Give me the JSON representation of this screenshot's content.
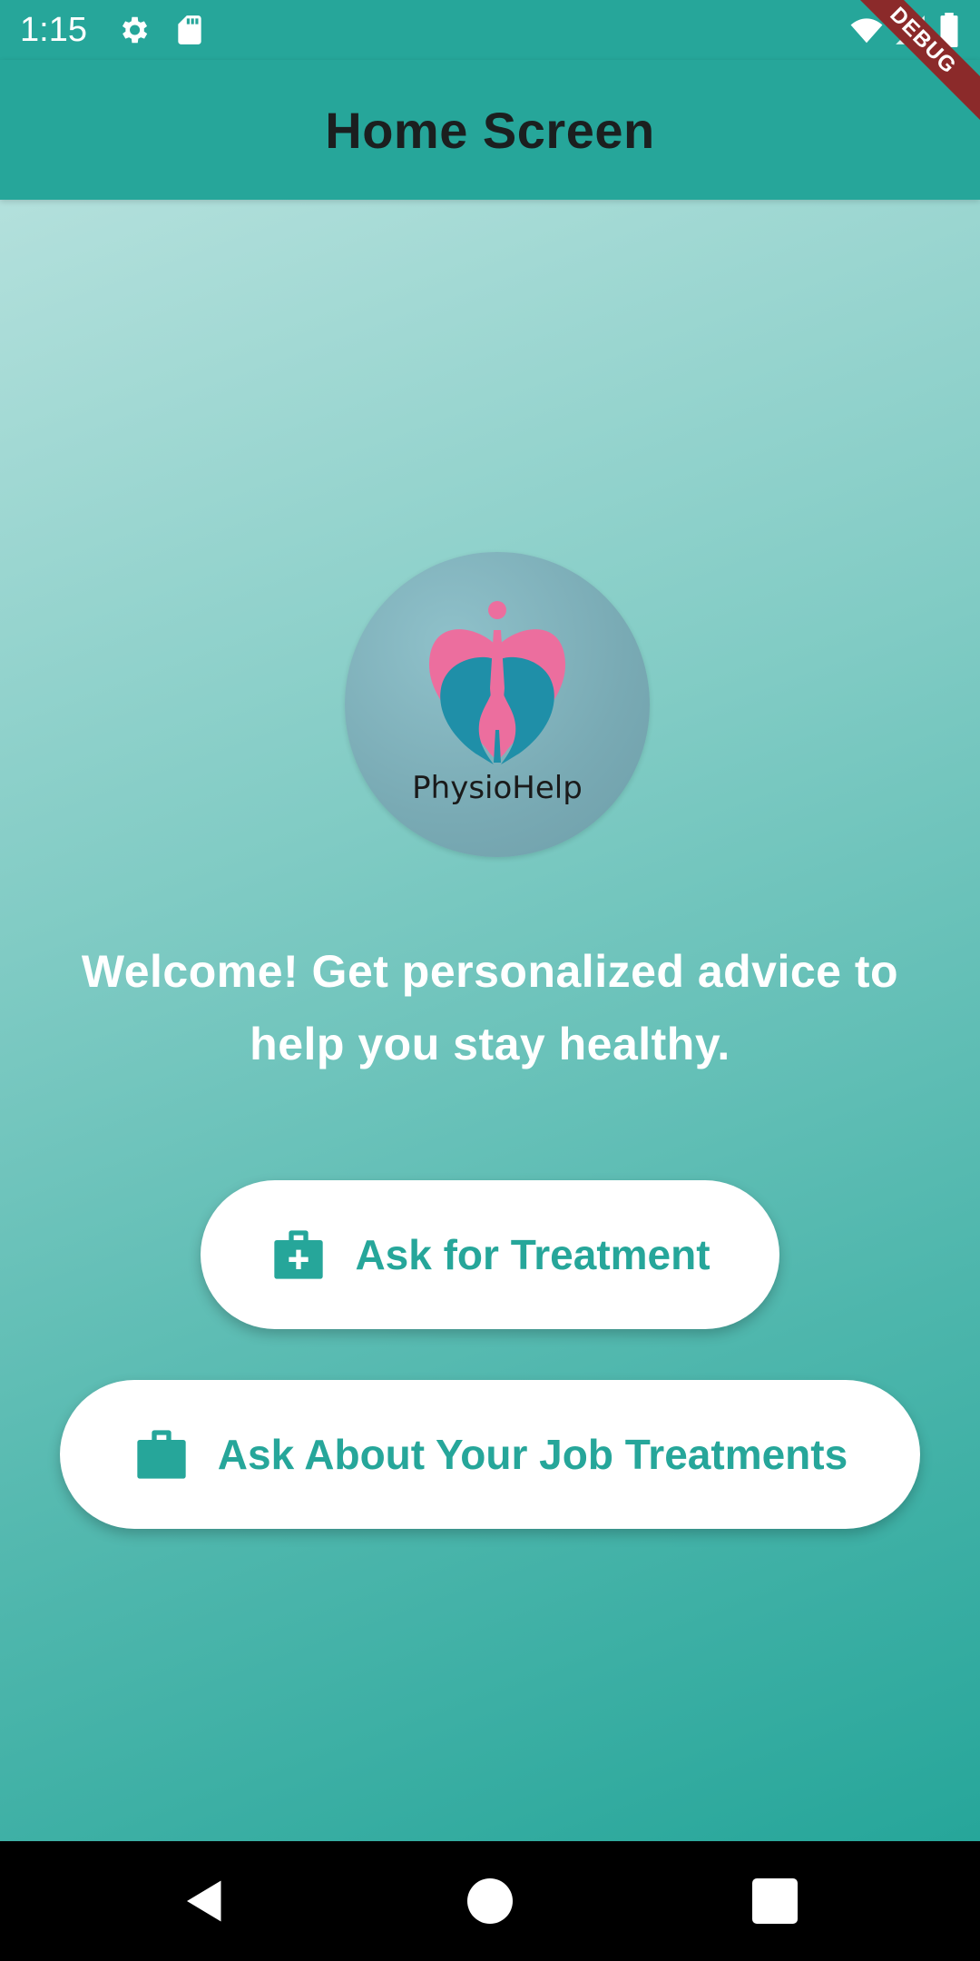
{
  "status_bar": {
    "time": "1:15",
    "icons": [
      "gear-icon",
      "sd-card-icon",
      "wifi-icon",
      "signal-icon",
      "battery-icon"
    ]
  },
  "debug_banner": "DEBUG",
  "app_bar": {
    "title": "Home Screen"
  },
  "logo": {
    "text": "PhysioHelp",
    "colors": {
      "pink": "#ec6e9e",
      "teal": "#1f8fa8"
    }
  },
  "welcome_text": "Welcome! Get personalized advice to help you stay healthy.",
  "buttons": [
    {
      "label": "Ask for Treatment",
      "icon": "medical-bag-icon"
    },
    {
      "label": "Ask About Your Job Treatments",
      "icon": "briefcase-icon"
    }
  ],
  "nav_bar": {
    "icons": [
      "back-icon",
      "home-icon",
      "recents-icon"
    ]
  },
  "colors": {
    "primary": "#26a69a",
    "banner": "#8b2a2a"
  }
}
